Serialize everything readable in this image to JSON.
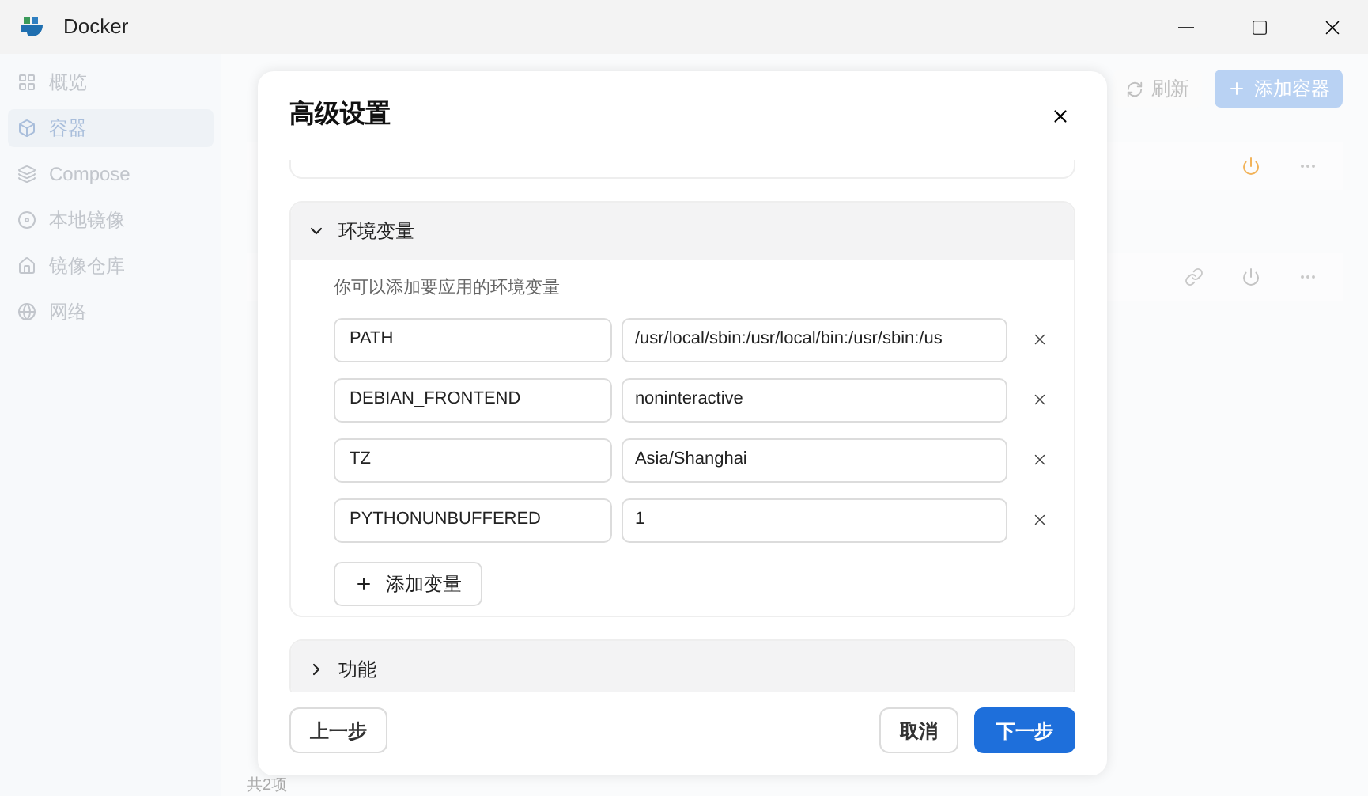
{
  "window": {
    "title": "Docker"
  },
  "sidebar": {
    "items": [
      {
        "label": "概览",
        "selected": false
      },
      {
        "label": "容器",
        "selected": true
      },
      {
        "label": "Compose",
        "selected": false
      },
      {
        "label": "本地镜像",
        "selected": false
      },
      {
        "label": "镜像仓库",
        "selected": false
      },
      {
        "label": "网络",
        "selected": false
      }
    ]
  },
  "toolbar": {
    "buttons": [
      {
        "label": "刷新",
        "kind": "secondary"
      },
      {
        "label": "添加容器",
        "kind": "primary"
      }
    ]
  },
  "containers": [
    {
      "kind": "plain",
      "color": "#f2b35a"
    },
    {
      "kind": "linked",
      "color": "#c4c4c4"
    }
  ],
  "footer": {
    "count": "共2项"
  },
  "dialog": {
    "title": "高级设置",
    "sections": [
      {
        "title": "环境变量",
        "expanded": true,
        "hint": "你可以添加要应用的环境变量",
        "variables": [
          {
            "key": "PATH",
            "value": "/usr/local/sbin:/usr/local/bin:/usr/sbin:/us"
          },
          {
            "key": "DEBIAN_FRONTEND",
            "value": "noninteractive"
          },
          {
            "key": "TZ",
            "value": "Asia/Shanghai"
          },
          {
            "key": "PYTHONUNBUFFERED",
            "value": "1"
          }
        ],
        "add_button": "添加变量"
      },
      {
        "title": "功能",
        "expanded": false
      }
    ],
    "buttons": [
      {
        "label": "上一步",
        "kind": "secondary"
      },
      {
        "label": "取消",
        "kind": "secondary"
      },
      {
        "label": "下一步",
        "kind": "primary"
      }
    ]
  }
}
